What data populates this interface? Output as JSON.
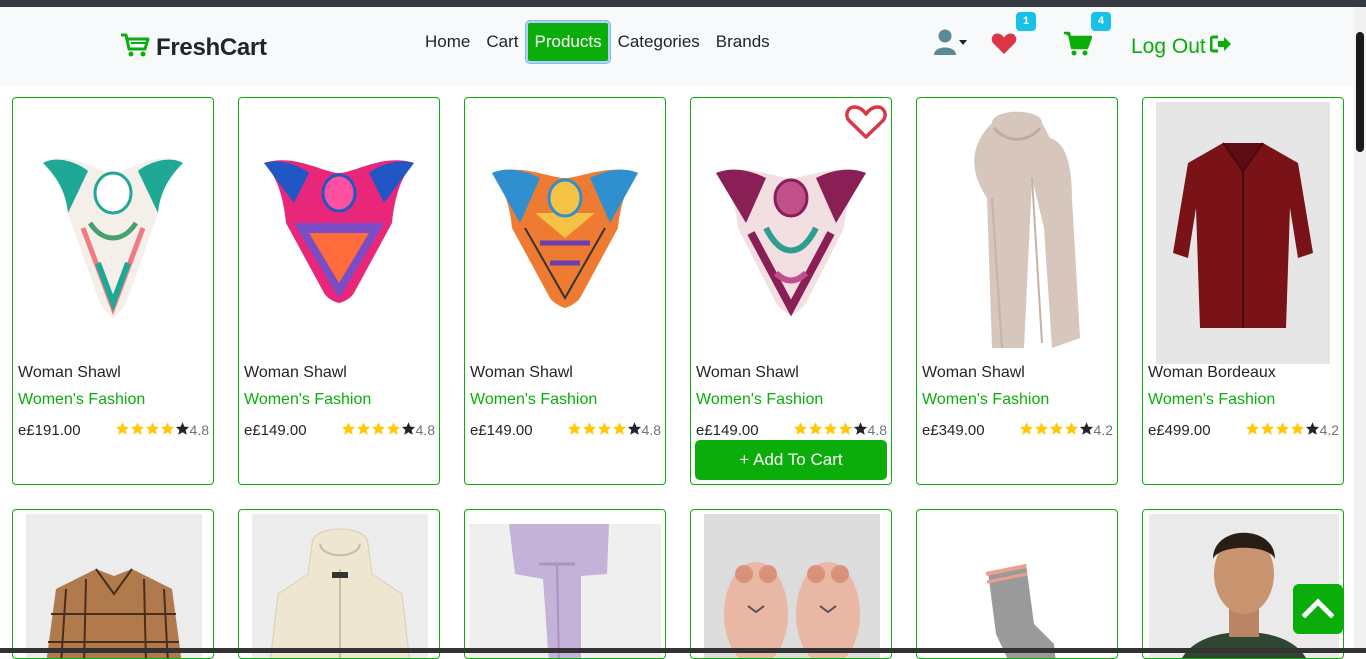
{
  "brand": {
    "name": "FreshCart",
    "icon": "cart-shopping-icon"
  },
  "nav": {
    "links": [
      {
        "label": "Home",
        "active": false
      },
      {
        "label": "Cart",
        "active": false
      },
      {
        "label": "Products",
        "active": true
      },
      {
        "label": "Categories",
        "active": false
      },
      {
        "label": "Brands",
        "active": false
      }
    ],
    "wishlist_count": "1",
    "cart_count": "4",
    "logout_label": "Log Out"
  },
  "products": [
    {
      "title": "Woman Shawl",
      "category": "Women's Fashion",
      "price": "e£191.00",
      "rating": "4.8",
      "stars": 4,
      "image": "shawl-1"
    },
    {
      "title": "Woman Shawl",
      "category": "Women's Fashion",
      "price": "e£149.00",
      "rating": "4.8",
      "stars": 4,
      "image": "shawl-2"
    },
    {
      "title": "Woman Shawl",
      "category": "Women's Fashion",
      "price": "e£149.00",
      "rating": "4.8",
      "stars": 4,
      "image": "shawl-3"
    },
    {
      "title": "Woman Shawl",
      "category": "Women's Fashion",
      "price": "e£149.00",
      "rating": "4.8",
      "stars": 4,
      "image": "shawl-4",
      "hovered": true,
      "add_to_cart_label": "+ Add To Cart"
    },
    {
      "title": "Woman Shawl",
      "category": "Women's Fashion",
      "price": "e£349.00",
      "rating": "4.2",
      "stars": 4,
      "image": "scarf-beige"
    },
    {
      "title": "Woman Bordeaux",
      "category": "Women's Fashion",
      "price": "e£499.00",
      "rating": "4.2",
      "stars": 4,
      "image": "shirt-bordeaux"
    }
  ],
  "colors": {
    "accent": "#0aad0a",
    "star": "#ffc908",
    "heart": "#dc3545",
    "badge": "#17c1e8"
  }
}
